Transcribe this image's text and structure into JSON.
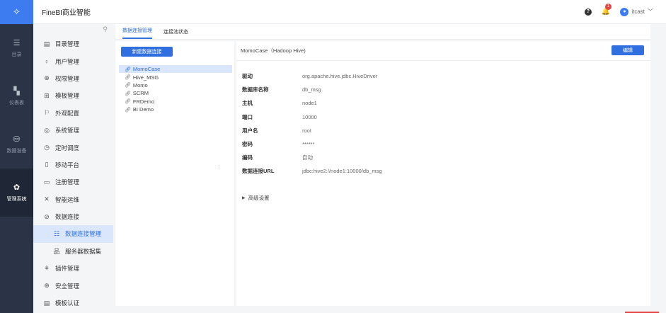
{
  "rail": {
    "items": [
      {
        "label": "目录",
        "icon": "list-icon"
      },
      {
        "label": "仪表板",
        "icon": "dashboard-icon"
      },
      {
        "label": "数据准备",
        "icon": "database-icon"
      },
      {
        "label": "管理系统",
        "icon": "gear-icon"
      }
    ]
  },
  "header": {
    "title": "FineBI商业智能",
    "notification_count": "1",
    "user": "itcast"
  },
  "sidebar": {
    "items": [
      {
        "label": "目录管理",
        "icon": "folder-icon"
      },
      {
        "label": "用户管理",
        "icon": "user-icon"
      },
      {
        "label": "权限管理",
        "icon": "lock-icon"
      },
      {
        "label": "模板管理",
        "icon": "template-icon"
      },
      {
        "label": "外观配置",
        "icon": "palette-icon"
      },
      {
        "label": "系统管理",
        "icon": "settings-icon"
      },
      {
        "label": "定时调度",
        "icon": "clock-icon"
      },
      {
        "label": "移动平台",
        "icon": "mobile-icon"
      },
      {
        "label": "注册管理",
        "icon": "register-icon"
      },
      {
        "label": "智能运维",
        "icon": "ops-icon"
      },
      {
        "label": "数据连接",
        "icon": "link-icon"
      },
      {
        "label": "数据连接管理",
        "icon": "connection-icon"
      },
      {
        "label": "服务器数据集",
        "icon": "dataset-icon"
      },
      {
        "label": "插件管理",
        "icon": "plugin-icon"
      },
      {
        "label": "安全管理",
        "icon": "shield-icon"
      },
      {
        "label": "模板认证",
        "icon": "certificate-icon"
      }
    ]
  },
  "tabs": [
    {
      "label": "数据连接管理"
    },
    {
      "label": "连接池状态"
    }
  ],
  "connections": {
    "new_button": "新建数据连接",
    "items": [
      "MomoCase",
      "Hive_MSG",
      "Momo",
      "SCRM",
      "FRDemo",
      "BI Demo"
    ]
  },
  "detail": {
    "title": "MomoCase（Hadoop Hive)",
    "edit_button": "编辑",
    "props": [
      {
        "key": "驱动",
        "value": "org.apache.hive.jdbc.HiveDriver"
      },
      {
        "key": "数据库名称",
        "value": "db_msg"
      },
      {
        "key": "主机",
        "value": "node1"
      },
      {
        "key": "端口",
        "value": "10000"
      },
      {
        "key": "用户名",
        "value": "root"
      },
      {
        "key": "密码",
        "value": "******"
      },
      {
        "key": "编码",
        "value": "自动"
      },
      {
        "key": "数据连接URL",
        "value": "jdbc:hive2://node1:10000/db_msg"
      }
    ],
    "advanced": "高级设置"
  }
}
